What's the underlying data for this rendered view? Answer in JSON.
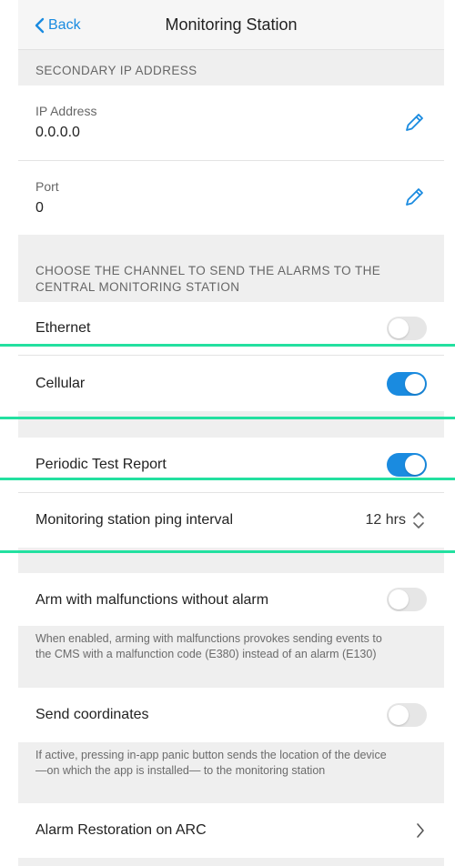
{
  "header": {
    "back_label": "Back",
    "title": "Monitoring Station"
  },
  "secondary_ip": {
    "section_title": "SECONDARY IP ADDRESS",
    "ip_label": "IP Address",
    "ip_value": "0.0.0.0",
    "port_label": "Port",
    "port_value": "0"
  },
  "channel": {
    "section_title_line1": "CHOOSE THE CHANNEL TO SEND THE ALARMS TO THE",
    "section_title_line2": "CENTRAL MONITORING STATION",
    "ethernet_label": "Ethernet",
    "ethernet_enabled": false,
    "cellular_label": "Cellular",
    "cellular_enabled": true
  },
  "periodic": {
    "label": "Periodic Test Report",
    "enabled": true,
    "ping_label": "Monitoring station ping interval",
    "ping_value": "12 hrs"
  },
  "arm_malfunctions": {
    "label": "Arm with malfunctions without alarm",
    "enabled": false,
    "desc_line1": "When enabled, arming with malfunctions provokes sending events to",
    "desc_line2": "the CMS with a malfunction code (E380) instead of an alarm (E130)"
  },
  "send_coordinates": {
    "label": "Send coordinates",
    "enabled": false,
    "desc_line1": "If active, pressing in-app panic button sends the location of the device",
    "desc_line2": "—on which the app is installed— to the monitoring station"
  },
  "alarm_restoration": {
    "label": "Alarm Restoration on ARC"
  },
  "colors": {
    "accent": "#1a8be0",
    "highlight": "#23e0a0",
    "background": "#efefef"
  }
}
